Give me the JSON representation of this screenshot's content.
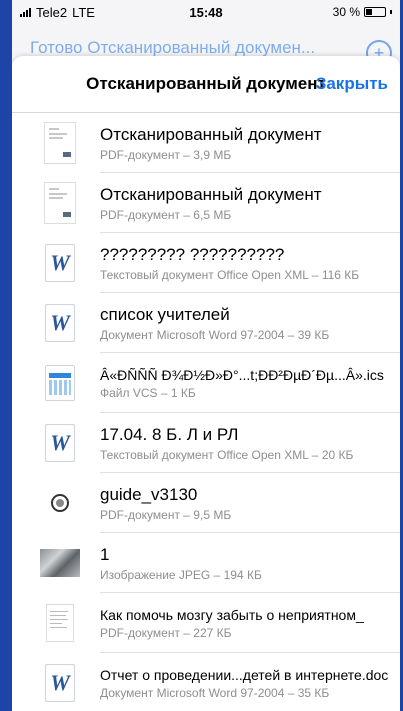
{
  "status_bar": {
    "carrier": "Tele2",
    "network": "LTE",
    "time": "15:48",
    "battery": "30 %"
  },
  "background_nav": {
    "title": "Готово   Отсканированный докумен..."
  },
  "sheet": {
    "title": "Отсканированный документ",
    "close_label": "Закрыть"
  },
  "files": [
    {
      "name": "Отсканированный документ",
      "meta": "PDF-документ – 3,9 МБ",
      "icon": "scanned-document-icon"
    },
    {
      "name": "Отсканированный документ",
      "meta": "PDF-документ – 6,5 МБ",
      "icon": "scanned-document-icon"
    },
    {
      "name": "????????? ??????????",
      "meta": "Текстовый документ Office Open XML – 116 КБ",
      "icon": "word-document-icon"
    },
    {
      "name": "список учителей",
      "meta": "Документ Microsoft Word 97-2004 – 39 КБ",
      "icon": "word-document-icon"
    },
    {
      "name": "Â«ÐÑÑÑ Ð¾Ð½Ð»Ð°...t;ÐÐ²ÐµÐ´Ðµ...Â».ics",
      "meta": "Файл VCS – 1 КБ",
      "icon": "calendar-file-icon"
    },
    {
      "name": "17.04. 8 Б. Л и РЛ",
      "meta": "Текстовый документ Office Open XML – 20 КБ",
      "icon": "word-document-icon"
    },
    {
      "name": "guide_v3130",
      "meta": "PDF-документ – 9,5 МБ",
      "icon": "guide-pdf-icon"
    },
    {
      "name": "1",
      "meta": "Изображение JPEG – 194 КБ",
      "icon": "photo-thumbnail-icon"
    },
    {
      "name": "Как помочь мозгу забыть о неприятном_",
      "meta": "PDF-документ – 227 КБ",
      "icon": "pdf-page-icon"
    },
    {
      "name": "Отчет о проведении...детей в интернете.doc",
      "meta": "Документ Microsoft Word 97-2004 – 35 КБ",
      "icon": "word-document-icon"
    }
  ],
  "colors": {
    "accent": "#1a72e8",
    "frame": "#1d44a6",
    "word_blue": "#2b579a"
  }
}
